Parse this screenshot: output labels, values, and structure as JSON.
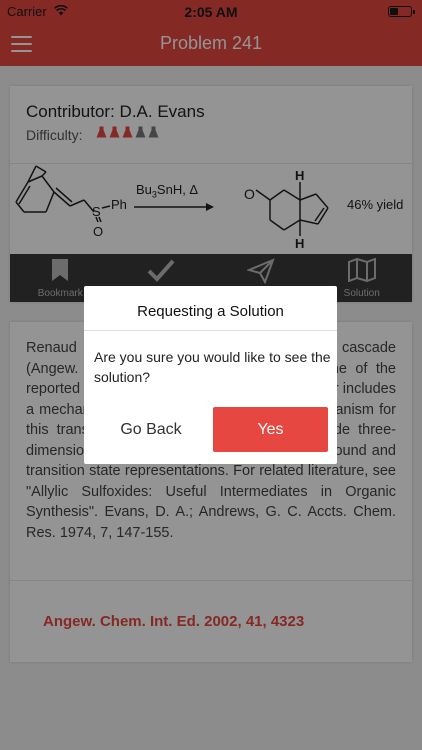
{
  "status_bar": {
    "carrier": "Carrier",
    "time": "2:05 AM"
  },
  "header": {
    "title": "Problem 241",
    "color": "#e64740"
  },
  "problem": {
    "contributor": "Contributor: D.A. Evans",
    "difficulty_label": "Difficulty:",
    "difficulty_level": 3,
    "difficulty_max": 5,
    "reaction": {
      "reagent_prefix": "Bu",
      "reagent_sub1": "3",
      "reagent_suffix": "SnH, Δ",
      "reactant_label_s": "S",
      "reactant_label_ph": "Ph",
      "reactant_label_o": "O",
      "product_label_o": "O",
      "product_label_h_top": "H",
      "product_label_h_bottom": "H",
      "yield": "46% yield"
    }
  },
  "toolbar": {
    "items": [
      {
        "label": "Bookmark",
        "icon": "bookmark-icon"
      },
      {
        "label": "",
        "icon": "check-icon"
      },
      {
        "label": "",
        "icon": "send-icon"
      },
      {
        "label": "Solution",
        "icon": "map-icon"
      }
    ]
  },
  "description": {
    "text": "Renaud has disclosed an interesting reaction cascade (Angew. Chem. Int. Ed. 2002, 41, 4323). One of the reported transformations is illustrated. The paper includes a mechanism. Please provide a plausible mechanism for this transformation. Your answer should include three-dimensional structures that accurately depict ground and transition state representations. For related literature, see \"Allylic Sulfoxides: Useful Intermediates in Organic Synthesis\". Evans, D. A.; Andrews, G. C. Accts. Chem. Res. 1974, 7, 147-155.",
    "citation": "Angew. Chem. Int. Ed. 2002, 41, 4323"
  },
  "dialog": {
    "title": "Requesting a Solution",
    "message": "Are you sure you would like to see the solution?",
    "cancel_label": "Go Back",
    "confirm_label": "Yes",
    "confirm_color": "#e64740"
  }
}
